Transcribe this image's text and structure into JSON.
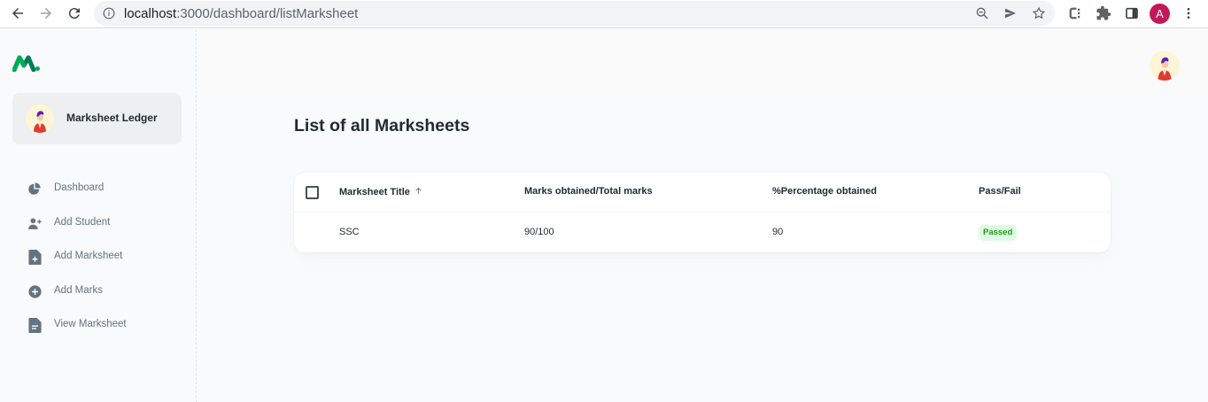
{
  "browser": {
    "url_host": "localhost",
    "url_rest": ":3000/dashboard/listMarksheet",
    "profile_initial": "A"
  },
  "sidebar": {
    "account_name": "Marksheet Ledger",
    "items": [
      {
        "label": "Dashboard",
        "icon": "pie-chart-icon"
      },
      {
        "label": "Add Student",
        "icon": "person-add-icon"
      },
      {
        "label": "Add Marksheet",
        "icon": "file-add-icon"
      },
      {
        "label": "Add Marks",
        "icon": "plus-circle-icon"
      },
      {
        "label": "View Marksheet",
        "icon": "file-text-icon"
      }
    ]
  },
  "main": {
    "title": "List of all Marksheets",
    "table": {
      "headers": [
        "Marksheet Title",
        "Marks obtained/Total marks",
        "%Percentage obtained",
        "Pass/Fail"
      ],
      "rows": [
        {
          "title": "SSC",
          "marks": "90/100",
          "percentage": "90",
          "status": "Passed"
        }
      ]
    }
  },
  "colors": {
    "brand": "#00ab55",
    "status_passed_bg": "#dcfce3",
    "status_passed_text": "#229a16",
    "profile": "#c2185b"
  }
}
